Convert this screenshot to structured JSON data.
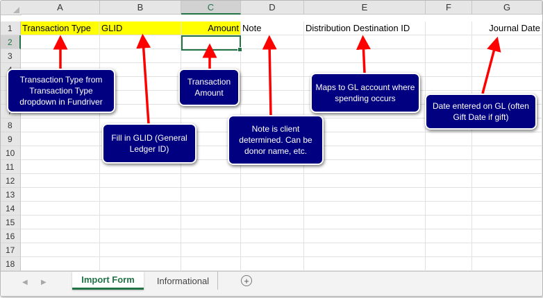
{
  "columns": [
    "A",
    "B",
    "C",
    "D",
    "E",
    "F",
    "G"
  ],
  "selected_column": "C",
  "rows": [
    "1",
    "2",
    "3",
    "4",
    "5",
    "6",
    "7",
    "8",
    "9",
    "10",
    "11",
    "12",
    "13",
    "14",
    "15",
    "16",
    "17",
    "18"
  ],
  "selected_row": "2",
  "header_row": {
    "a": "Transaction Type",
    "b": "GLID",
    "c": "Amount",
    "d": "Note",
    "e": "Distribution Destination ID",
    "g": "Journal Date"
  },
  "header_fill_color": "#ffff00",
  "sheet_tabs": {
    "active": "Import Form",
    "inactive": "Informational"
  },
  "add_sheet_icon": "plus-circle-icon",
  "callouts": {
    "transaction_type": "Transaction Type from Transaction Type dropdown in Fundriver",
    "glid": "Fill in GLID (General Ledger ID)",
    "amount": "Transaction Amount",
    "note": "Note is client determined.  Can be donor name, etc.",
    "distribution": "Maps to GL account where spending occurs",
    "journal_date": "Date entered on GL (often Gift Date if gift)"
  },
  "colors": {
    "excel_green": "#217346",
    "callout_bg": "#000080",
    "arrow": "#ff0000"
  }
}
